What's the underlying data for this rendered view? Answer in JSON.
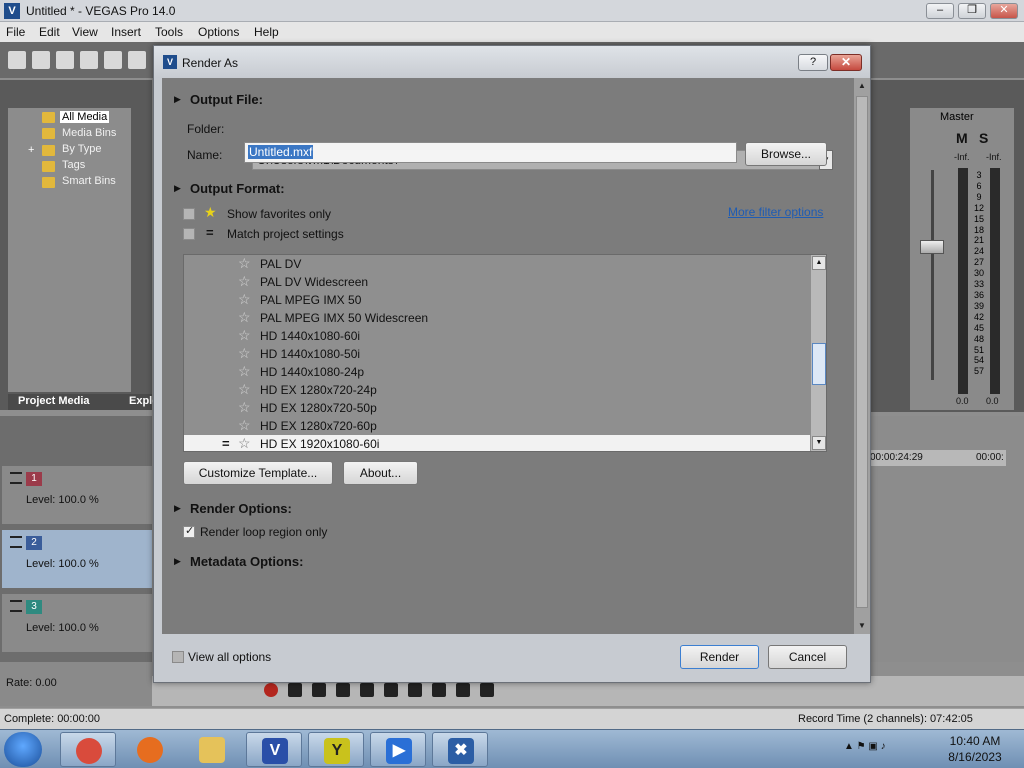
{
  "window": {
    "title": "Untitled * - VEGAS Pro 14.0",
    "minimize": "–",
    "maximize": "❐",
    "close": "✕"
  },
  "menu": [
    "File",
    "Edit",
    "View",
    "Insert",
    "Tools",
    "Options",
    "Help"
  ],
  "explorer": {
    "items": [
      "All Media",
      "Media Bins",
      "By Type",
      "Tags",
      "Smart Bins"
    ],
    "expander": "+",
    "tabs": [
      "Project Media",
      "Explo"
    ]
  },
  "tracks": [
    {
      "number": "1",
      "level": "Level: 100.0 %",
      "color": "#9b3b4a"
    },
    {
      "number": "2",
      "level": "Level: 100.0 %",
      "color": "#3a5d9a"
    },
    {
      "number": "3",
      "level": "Level: 100.0 %",
      "color": "#2f8a80"
    }
  ],
  "rate": "Rate: 0.00",
  "status": {
    "complete": "Complete: 00:00:00",
    "record_time": "Record Time (2 channels): 07:42:05"
  },
  "mixer": {
    "master": "Master",
    "m": "M",
    "s": "S",
    "inf_left": "-Inf.",
    "inf_right": "-Inf.",
    "scale": [
      "3",
      "6",
      "9",
      "12",
      "15",
      "18",
      "21",
      "24",
      "27",
      "30",
      "33",
      "36",
      "39",
      "42",
      "45",
      "48",
      "51",
      "54",
      "57"
    ],
    "zero_left": "0.0",
    "zero_right": "0.0"
  },
  "ruler": {
    "t1": "00:00:24:29",
    "t2": "00:00:"
  },
  "dialog": {
    "title": "Render As",
    "help": "?",
    "close": "✕",
    "output_file": {
      "heading": "Output File:",
      "folder_label": "Folder:",
      "folder_value": "C:\\Users\\vm1\\Documents\\",
      "name_label": "Name:",
      "name_value": "Untitled.mxf",
      "browse": "Browse..."
    },
    "output_format": {
      "heading": "Output Format:",
      "favorites": "Show favorites only",
      "favorites_checked": false,
      "match": "Match project settings",
      "match_checked": false,
      "more_filter": "More filter options",
      "templates": [
        {
          "name": "PAL DV",
          "selected": false
        },
        {
          "name": "PAL DV Widescreen",
          "selected": false
        },
        {
          "name": "PAL MPEG IMX 50",
          "selected": false
        },
        {
          "name": "PAL MPEG IMX 50 Widescreen",
          "selected": false
        },
        {
          "name": "HD 1440x1080-60i",
          "selected": false
        },
        {
          "name": "HD 1440x1080-50i",
          "selected": false
        },
        {
          "name": "HD 1440x1080-24p",
          "selected": false
        },
        {
          "name": "HD EX 1280x720-24p",
          "selected": false
        },
        {
          "name": "HD EX 1280x720-50p",
          "selected": false
        },
        {
          "name": "HD EX 1280x720-60p",
          "selected": false
        },
        {
          "name": "HD EX 1920x1080-60i",
          "selected": true
        }
      ],
      "match_marker": "=",
      "customize": "Customize Template...",
      "about": "About..."
    },
    "render_options": {
      "heading": "Render Options:",
      "loop": "Render loop region only",
      "loop_checked": true
    },
    "metadata": {
      "heading": "Metadata Options:"
    },
    "footer": {
      "view_all": "View all options",
      "view_all_checked": false,
      "render": "Render",
      "cancel": "Cancel"
    }
  },
  "taskbar": {
    "apps": [
      {
        "name": "chrome",
        "glyph": "",
        "color": "#d94b3c"
      },
      {
        "name": "firefox",
        "glyph": "",
        "color": "#e66d1f"
      },
      {
        "name": "file-explorer",
        "glyph": "",
        "color": "#e5c25a"
      },
      {
        "name": "vegas-suite",
        "glyph": "V",
        "color": "#2a4fa8"
      },
      {
        "name": "vegas-y",
        "glyph": "Y",
        "color": "#c9c21c"
      },
      {
        "name": "vegas-player",
        "glyph": "▶",
        "color": "#2a6fd6"
      },
      {
        "name": "vegas-pro",
        "glyph": "✖",
        "color": "#2c5ea5"
      }
    ],
    "time": "10:40 AM",
    "date": "8/16/2023"
  }
}
